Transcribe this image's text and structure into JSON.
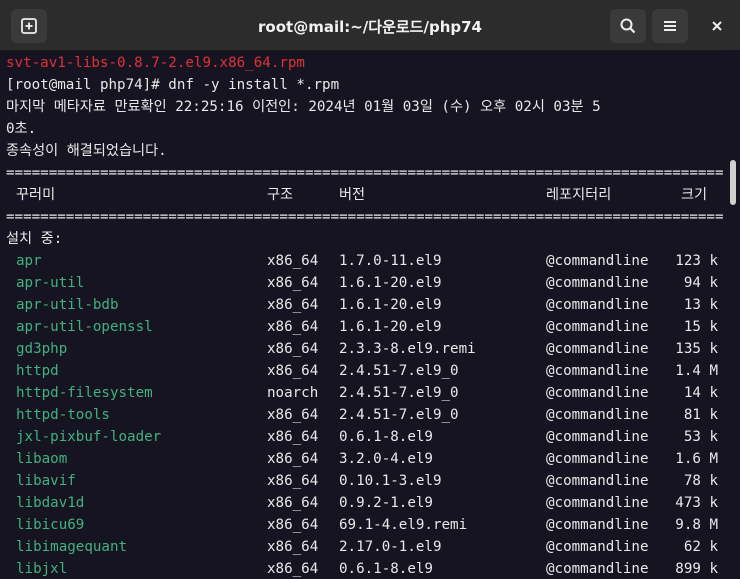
{
  "window": {
    "title": "root@mail:~/다운로드/php74",
    "icons": {
      "new_tab": "new-tab-icon",
      "search": "search-icon",
      "menu": "hamburger-menu-icon",
      "close": "close-icon"
    }
  },
  "terminal": {
    "top_lines": [
      {
        "text": "svt-av1-libs-0.8.7-2.el9.x86_64.rpm",
        "style": "red"
      },
      {
        "text": "[root@mail php74]# dnf -y install *.rpm",
        "style": "normal"
      },
      {
        "text": "마지막 메타자료 만료확인 22:25:16 이전인: 2024년 01월 03일 (수) 오후 02시 03분 5",
        "style": "normal"
      },
      {
        "text": "0초.",
        "style": "normal"
      },
      {
        "text": "종속성이 해결되었습니다.",
        "style": "normal"
      }
    ],
    "separator": "================================================================================================",
    "headers": {
      "package": "꾸러미",
      "arch": "구조",
      "version": "버전",
      "repo": "레포지터리",
      "size": "크기"
    },
    "section_label": "설치 중:",
    "packages": [
      {
        "name": "apr",
        "arch": "x86_64",
        "version": "1.7.0-11.el9",
        "repo": "@commandline",
        "size": "123 k"
      },
      {
        "name": "apr-util",
        "arch": "x86_64",
        "version": "1.6.1-20.el9",
        "repo": "@commandline",
        "size": "94 k"
      },
      {
        "name": "apr-util-bdb",
        "arch": "x86_64",
        "version": "1.6.1-20.el9",
        "repo": "@commandline",
        "size": "13 k"
      },
      {
        "name": "apr-util-openssl",
        "arch": "x86_64",
        "version": "1.6.1-20.el9",
        "repo": "@commandline",
        "size": "15 k"
      },
      {
        "name": "gd3php",
        "arch": "x86_64",
        "version": "2.3.3-8.el9.remi",
        "repo": "@commandline",
        "size": "135 k"
      },
      {
        "name": "httpd",
        "arch": "x86_64",
        "version": "2.4.51-7.el9_0",
        "repo": "@commandline",
        "size": "1.4 M"
      },
      {
        "name": "httpd-filesystem",
        "arch": "noarch",
        "version": "2.4.51-7.el9_0",
        "repo": "@commandline",
        "size": "14 k"
      },
      {
        "name": "httpd-tools",
        "arch": "x86_64",
        "version": "2.4.51-7.el9_0",
        "repo": "@commandline",
        "size": "81 k"
      },
      {
        "name": "jxl-pixbuf-loader",
        "arch": "x86_64",
        "version": "0.6.1-8.el9",
        "repo": "@commandline",
        "size": "53 k"
      },
      {
        "name": "libaom",
        "arch": "x86_64",
        "version": "3.2.0-4.el9",
        "repo": "@commandline",
        "size": "1.6 M"
      },
      {
        "name": "libavif",
        "arch": "x86_64",
        "version": "0.10.1-3.el9",
        "repo": "@commandline",
        "size": "78 k"
      },
      {
        "name": "libdav1d",
        "arch": "x86_64",
        "version": "0.9.2-1.el9",
        "repo": "@commandline",
        "size": "473 k"
      },
      {
        "name": "libicu69",
        "arch": "x86_64",
        "version": "69.1-4.el9.remi",
        "repo": "@commandline",
        "size": "9.8 M"
      },
      {
        "name": "libimagequant",
        "arch": "x86_64",
        "version": "2.17.0-1.el9",
        "repo": "@commandline",
        "size": "62 k"
      },
      {
        "name": "libjxl",
        "arch": "x86_64",
        "version": "0.6.1-8.el9",
        "repo": "@commandline",
        "size": "899 k"
      }
    ]
  }
}
